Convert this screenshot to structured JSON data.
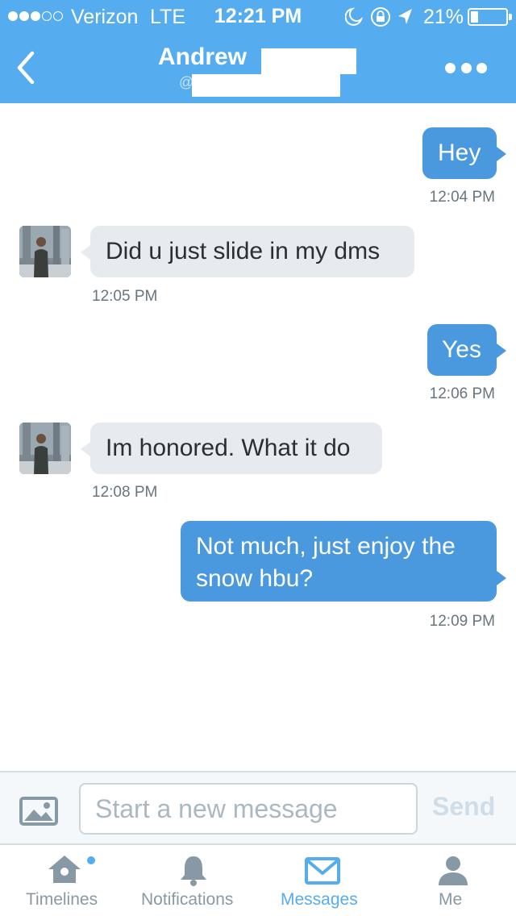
{
  "status_bar": {
    "carrier": "Verizon",
    "network": "LTE",
    "time": "12:21 PM",
    "battery_percent": "21%",
    "signal_bars_filled": 3,
    "signal_bars_total": 5,
    "battery_level": 0.21,
    "icons": [
      "do-not-disturb-moon-icon",
      "rotation-lock-icon",
      "location-arrow-icon",
      "battery-icon"
    ]
  },
  "nav": {
    "title": "Andrew",
    "handle_prefix": "@",
    "back_icon": "chevron-left-icon",
    "more_icon": "more-dots-icon"
  },
  "messages": [
    {
      "direction": "outgoing",
      "text": "Hey",
      "time": "12:04 PM"
    },
    {
      "direction": "incoming",
      "text": "Did u just slide in my dms",
      "time": "12:05 PM"
    },
    {
      "direction": "outgoing",
      "text": "Yes",
      "time": "12:06 PM"
    },
    {
      "direction": "incoming",
      "text": "Im honored. What it do",
      "time": "12:08 PM"
    },
    {
      "direction": "outgoing",
      "text": "Not much, just enjoy the snow hbu?",
      "time": "12:09 PM"
    }
  ],
  "composer": {
    "placeholder": "Start a new message",
    "value": "",
    "send_label": "Send",
    "photo_icon": "photo-icon"
  },
  "tabs": [
    {
      "label": "Timelines",
      "icon": "home-icon",
      "active": false,
      "has_badge": true
    },
    {
      "label": "Notifications",
      "icon": "bell-icon",
      "active": false
    },
    {
      "label": "Messages",
      "icon": "envelope-icon",
      "active": true
    },
    {
      "label": "Me",
      "icon": "person-icon",
      "active": false
    }
  ],
  "colors": {
    "brand_blue": "#55acee",
    "outgoing_bubble": "#4a98de",
    "incoming_bubble": "#e7ebef",
    "timestamp": "#66757f",
    "inactive_tab": "#8899a6"
  }
}
